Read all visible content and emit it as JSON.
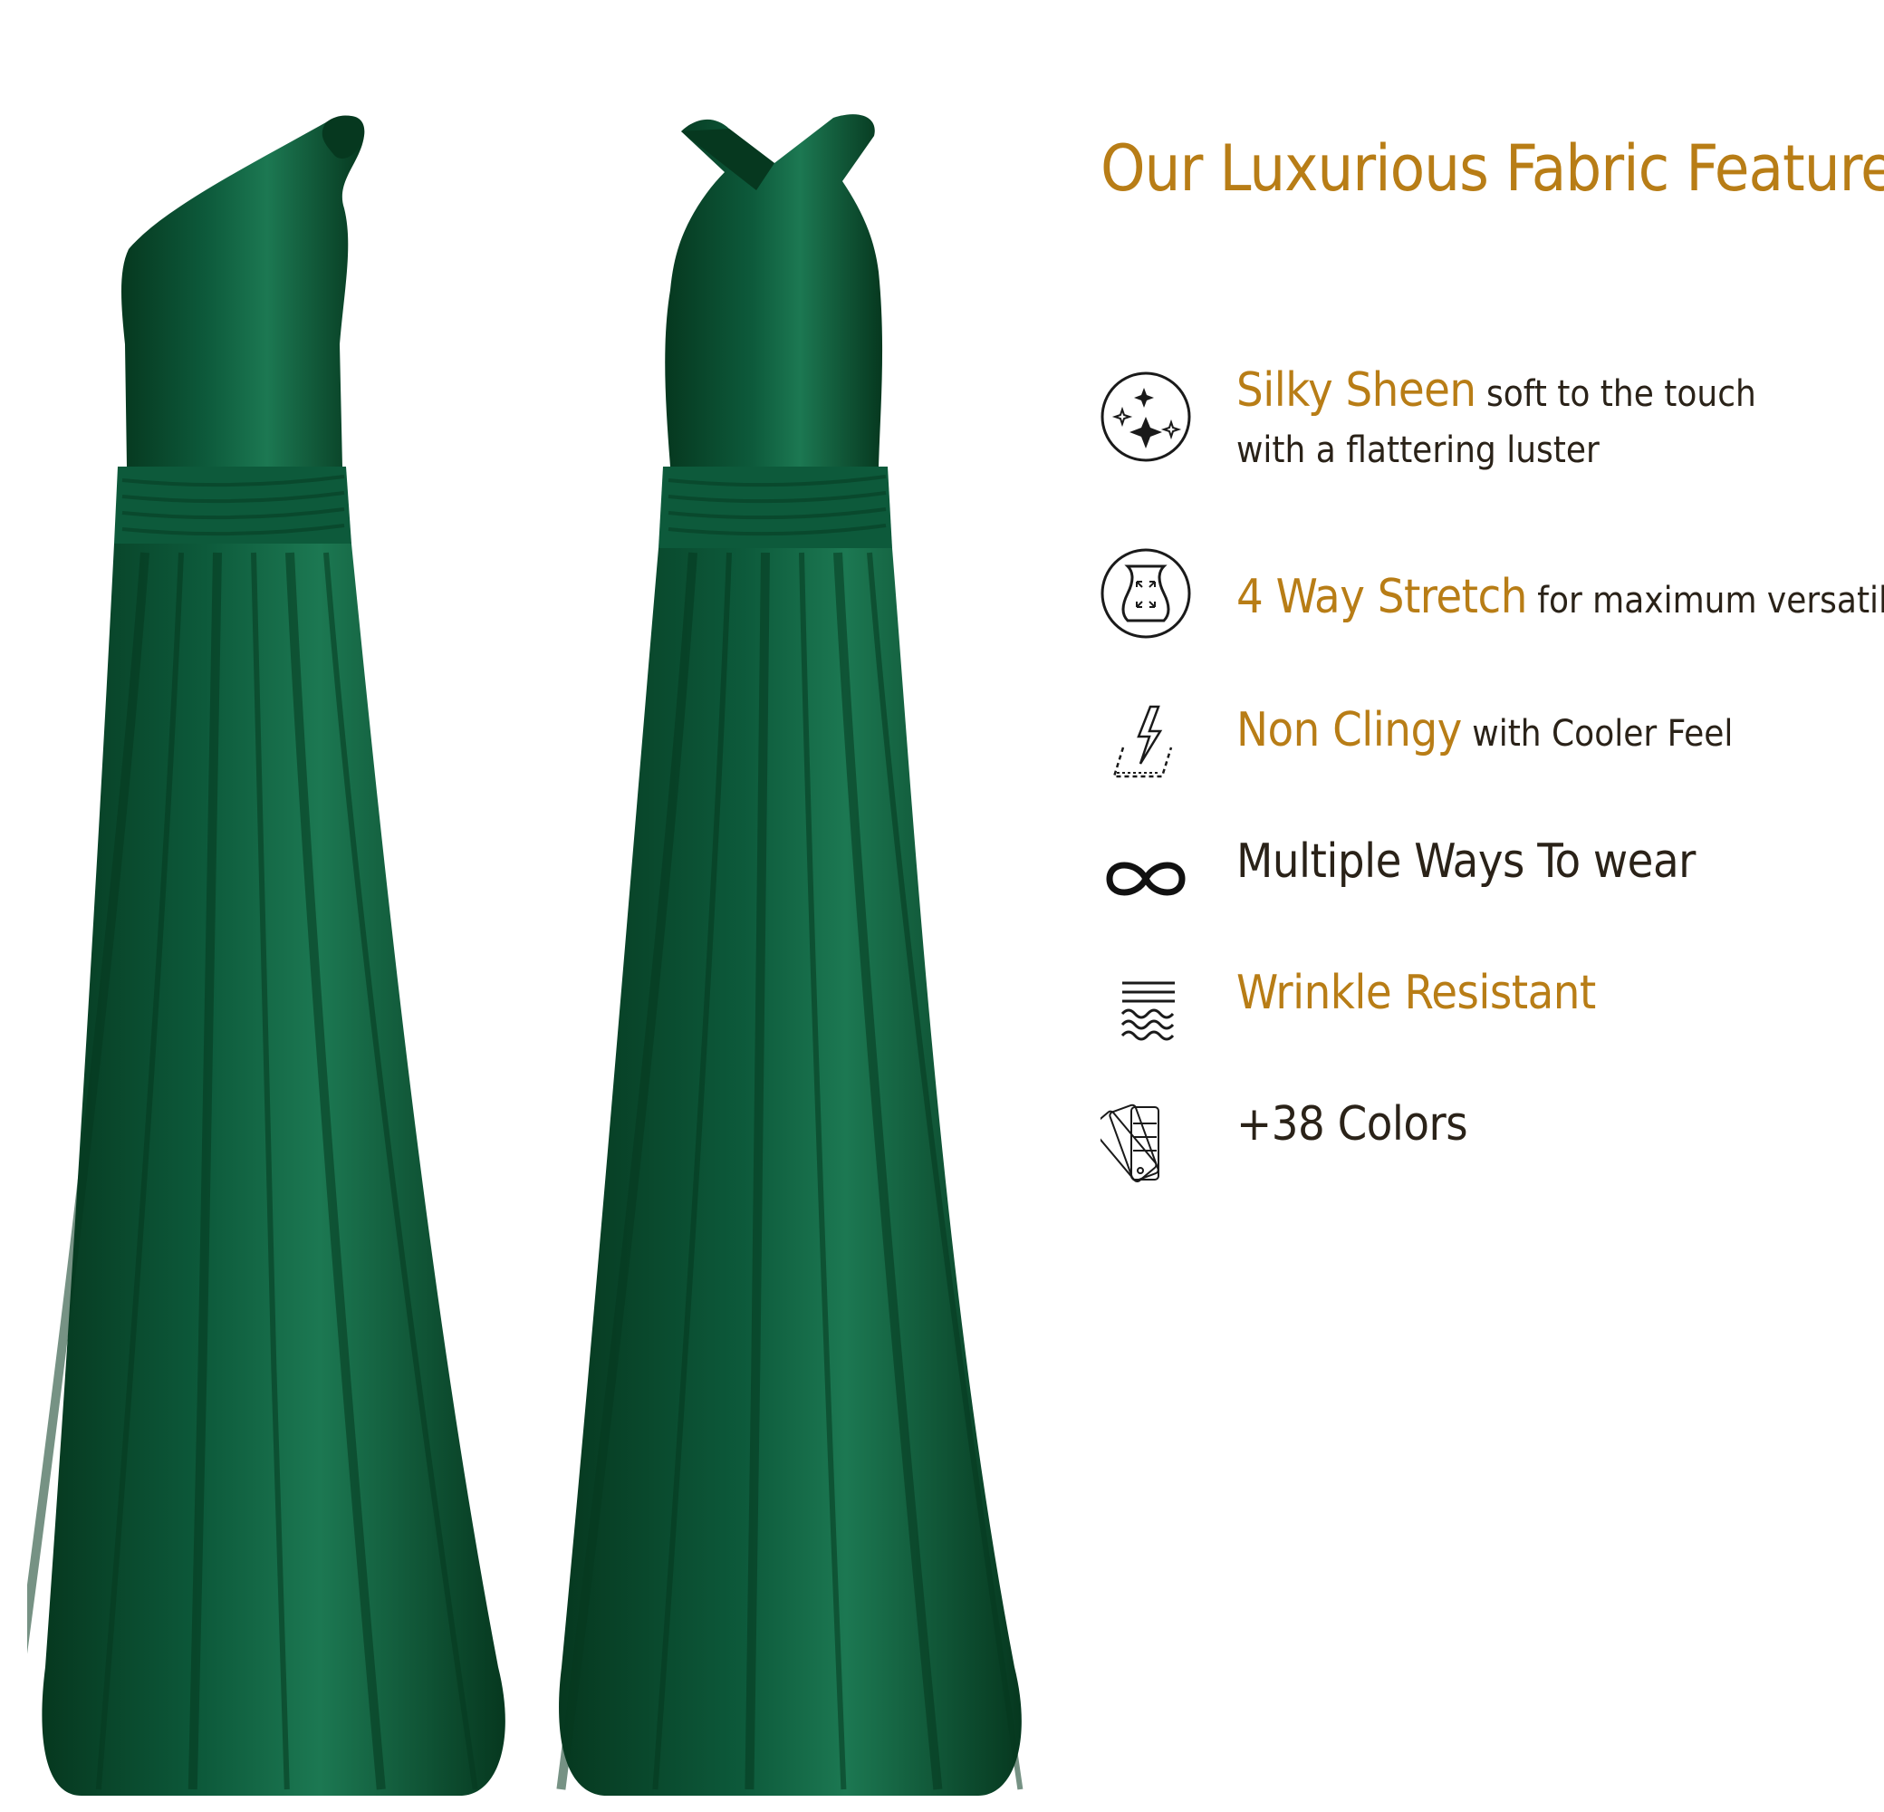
{
  "colors": {
    "accent": "#b87d16",
    "text": "#2a2218",
    "dress": "#0d5a3b",
    "dress_shadow": "#06381f",
    "dress_highlight": "#1c7852"
  },
  "product_images": [
    {
      "style": "one-shoulder",
      "color_name": "green"
    },
    {
      "style": "halter-cross",
      "color_name": "green"
    }
  ],
  "heading": "Our Luxurious Fabric Features:",
  "features": [
    {
      "icon": "sparkle-icon",
      "highlight": "Silky Sheen",
      "line1": " soft to the touch",
      "line2": "with a flattering luster"
    },
    {
      "icon": "stretch-icon",
      "highlight": "4 Way Stretch",
      "line1": " for maximum versatility"
    },
    {
      "icon": "lightning-icon",
      "highlight": "Non Clingy",
      "line1": " with Cooler Feel"
    },
    {
      "icon": "infinity-icon",
      "text": "Multiple Ways To wear"
    },
    {
      "icon": "wrinkle-icon",
      "highlight": "Wrinkle Resistant"
    },
    {
      "icon": "color-swatch-icon",
      "text": "+38 Colors"
    }
  ]
}
